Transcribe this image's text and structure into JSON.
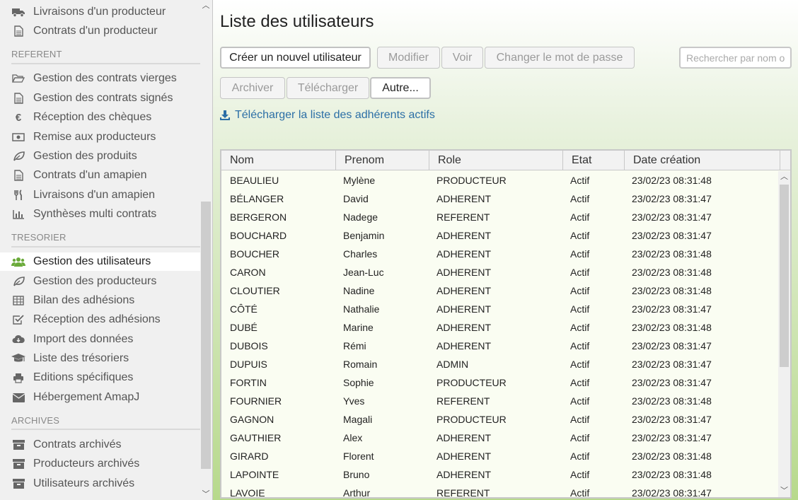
{
  "sidebar": {
    "items_top": [
      {
        "label": "Livraisons d'un producteur",
        "icon": "truck-icon"
      },
      {
        "label": "Contrats d'un producteur",
        "icon": "file-icon"
      }
    ],
    "sections": [
      {
        "title": "REFERENT",
        "items": [
          {
            "label": "Gestion des contrats vierges",
            "icon": "folder-open-icon"
          },
          {
            "label": "Gestion des contrats signés",
            "icon": "file-icon"
          },
          {
            "label": "Réception des chèques",
            "icon": "euro-icon"
          },
          {
            "label": "Remise aux producteurs",
            "icon": "money-icon"
          },
          {
            "label": "Gestion des produits",
            "icon": "leaf-icon"
          },
          {
            "label": "Contrats d'un amapien",
            "icon": "file-icon"
          },
          {
            "label": "Livraisons d'un amapien",
            "icon": "cutlery-icon"
          },
          {
            "label": "Synthèses multi contrats",
            "icon": "bar-chart-icon"
          }
        ]
      },
      {
        "title": "TRESORIER",
        "items": [
          {
            "label": "Gestion des utilisateurs",
            "icon": "users-icon",
            "active": true
          },
          {
            "label": "Gestion des producteurs",
            "icon": "leaf-icon"
          },
          {
            "label": "Bilan des adhésions",
            "icon": "table-icon"
          },
          {
            "label": "Réception des adhésions",
            "icon": "check-square-icon"
          },
          {
            "label": "Import des données",
            "icon": "cloud-download-icon"
          },
          {
            "label": "Liste des trésoriers",
            "icon": "graduation-cap-icon"
          },
          {
            "label": "Editions spécifiques",
            "icon": "print-icon"
          },
          {
            "label": "Hébergement AmapJ",
            "icon": "envelope-icon"
          }
        ]
      },
      {
        "title": "ARCHIVES",
        "items": [
          {
            "label": "Contrats archivés",
            "icon": "archive-icon"
          },
          {
            "label": "Producteurs archivés",
            "icon": "archive-icon"
          },
          {
            "label": "Utilisateurs archivés",
            "icon": "archive-icon"
          }
        ]
      }
    ]
  },
  "main": {
    "title": "Liste des utilisateurs",
    "buttons": {
      "create": "Créer un nouvel utilisateur",
      "edit": "Modifier",
      "view": "Voir",
      "change_password": "Changer le mot de passe",
      "archive": "Archiver",
      "download": "Télécharger",
      "other": "Autre..."
    },
    "search_placeholder": "Rechercher par nom ou prénom",
    "download_link": "Télécharger la liste des adhérents actifs",
    "colors": {
      "link": "#2c6fa6",
      "active_icon": "#6aaa3a"
    }
  },
  "table": {
    "columns": [
      "Nom",
      "Prenom",
      "Role",
      "Etat",
      "Date création"
    ],
    "rows": [
      [
        "BEAULIEU",
        "Mylène",
        "PRODUCTEUR",
        "Actif",
        "23/02/23 08:31:48"
      ],
      [
        "BÉLANGER",
        "David",
        "ADHERENT",
        "Actif",
        "23/02/23 08:31:47"
      ],
      [
        "BERGERON",
        "Nadege",
        "REFERENT",
        "Actif",
        "23/02/23 08:31:47"
      ],
      [
        "BOUCHARD",
        "Benjamin",
        "ADHERENT",
        "Actif",
        "23/02/23 08:31:47"
      ],
      [
        "BOUCHER",
        "Charles",
        "ADHERENT",
        "Actif",
        "23/02/23 08:31:48"
      ],
      [
        "CARON",
        "Jean-Luc",
        "ADHERENT",
        "Actif",
        "23/02/23 08:31:48"
      ],
      [
        "CLOUTIER",
        "Nadine",
        "ADHERENT",
        "Actif",
        "23/02/23 08:31:48"
      ],
      [
        "CÔTÉ",
        "Nathalie",
        "ADHERENT",
        "Actif",
        "23/02/23 08:31:47"
      ],
      [
        "DUBÉ",
        "Marine",
        "ADHERENT",
        "Actif",
        "23/02/23 08:31:48"
      ],
      [
        "DUBOIS",
        "Rémi",
        "ADHERENT",
        "Actif",
        "23/02/23 08:31:47"
      ],
      [
        "DUPUIS",
        "Romain",
        "ADMIN",
        "Actif",
        "23/02/23 08:31:47"
      ],
      [
        "FORTIN",
        "Sophie",
        "PRODUCTEUR",
        "Actif",
        "23/02/23 08:31:47"
      ],
      [
        "FOURNIER",
        "Yves",
        "REFERENT",
        "Actif",
        "23/02/23 08:31:48"
      ],
      [
        "GAGNON",
        "Magali",
        "PRODUCTEUR",
        "Actif",
        "23/02/23 08:31:47"
      ],
      [
        "GAUTHIER",
        "Alex",
        "ADHERENT",
        "Actif",
        "23/02/23 08:31:47"
      ],
      [
        "GIRARD",
        "Florent",
        "ADHERENT",
        "Actif",
        "23/02/23 08:31:48"
      ],
      [
        "LAPOINTE",
        "Bruno",
        "ADHERENT",
        "Actif",
        "23/02/23 08:31:48"
      ],
      [
        "LAVOIE",
        "Arthur",
        "REFERENT",
        "Actif",
        "23/02/23 08:31:47"
      ]
    ]
  }
}
